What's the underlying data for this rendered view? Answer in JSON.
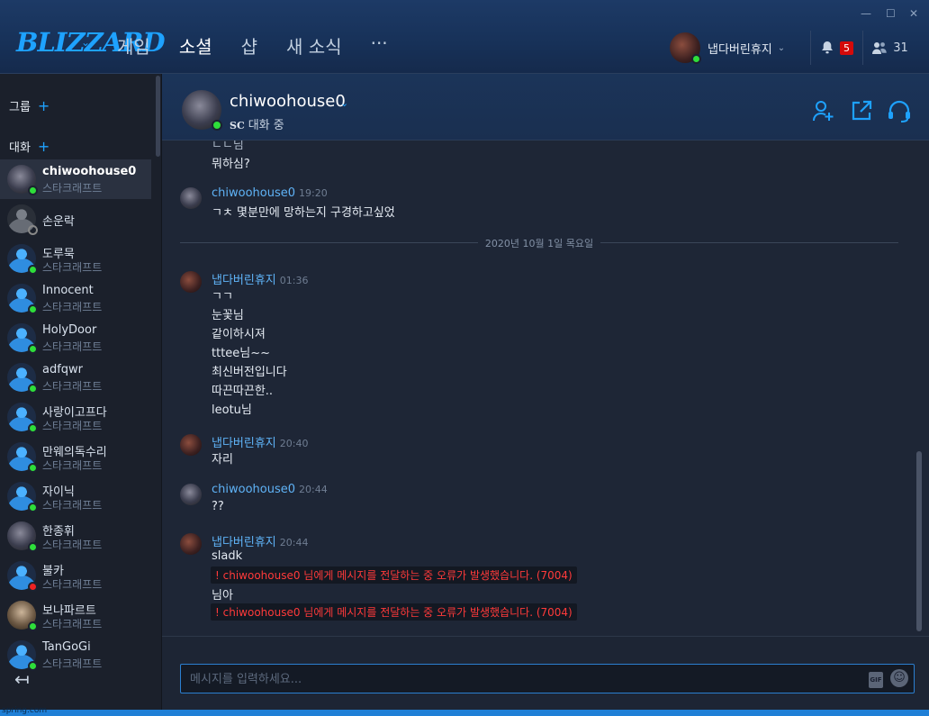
{
  "app": {
    "logo": "BLIZZARD",
    "nav": [
      "게임",
      "소셜",
      "샵",
      "새 소식",
      "···"
    ],
    "active_nav": 1,
    "window_controls": [
      "—",
      "☐",
      "✕"
    ]
  },
  "profile": {
    "name": "냅다버린휴지",
    "status": "online"
  },
  "notifications": {
    "count": "5"
  },
  "friends_online": {
    "count": "31"
  },
  "sidebar": {
    "groups_label": "그룹",
    "conversations_label": "대화",
    "friends": [
      {
        "name": "chiwoohouse0",
        "game": "스타크래프트",
        "status": "online",
        "avatar": "zerg",
        "selected": true
      },
      {
        "name": "손운락",
        "game": "",
        "status": "offline",
        "avatar": "grey"
      },
      {
        "name": "도루묵",
        "game": "스타크래프트",
        "status": "online",
        "avatar": "blue"
      },
      {
        "name": "Innocent",
        "game": "스타크래프트",
        "status": "online",
        "avatar": "blue"
      },
      {
        "name": "HolyDoor",
        "game": "스타크래프트",
        "status": "online",
        "avatar": "blue"
      },
      {
        "name": "adfqwr",
        "game": "스타크래프트",
        "status": "online",
        "avatar": "blue"
      },
      {
        "name": "사랑이고프다",
        "game": "스타크래프트",
        "status": "online",
        "avatar": "blue"
      },
      {
        "name": "만웨의독수리",
        "game": "스타크래프트",
        "status": "online",
        "avatar": "blue"
      },
      {
        "name": "자이닉",
        "game": "스타크래프트",
        "status": "online",
        "avatar": "blue"
      },
      {
        "name": "한종휘",
        "game": "스타크래프트",
        "status": "online",
        "avatar": "zerg"
      },
      {
        "name": "불카",
        "game": "스타크래프트",
        "status": "dnd",
        "avatar": "blue"
      },
      {
        "name": "보나파르트",
        "game": "스타크래프트",
        "status": "online",
        "avatar": "photo"
      },
      {
        "name": "TanGoGi",
        "game": "스타크래프트",
        "status": "online",
        "avatar": "blue"
      }
    ]
  },
  "chat": {
    "name": "chiwoohouse0",
    "status": "대화 중",
    "status_icon": "SC",
    "date_separator": "2020년 10월 1일 목요일",
    "top_partial_lines": [
      "ㄴㄴ님",
      "뭐하심?"
    ],
    "messages": [
      {
        "author": "chiwoohouse0",
        "time": "19:20",
        "avatar": "zerg",
        "lines": [
          "ㄱㅊ 몇분만에 망하는지 구경하고싶었"
        ]
      },
      {
        "author": "냅다버린휴지",
        "time": "01:36",
        "avatar": "me",
        "lines": [
          "ㄱㄱ",
          "눈꽃님",
          "같이하시져",
          "tttee님~~",
          "최신버전입니다",
          "따끈따끈한..",
          "leotu님"
        ]
      },
      {
        "author": "냅다버린휴지",
        "time": "20:40",
        "avatar": "me",
        "lines": [
          "자리"
        ]
      },
      {
        "author": "chiwoohouse0",
        "time": "20:44",
        "avatar": "zerg",
        "lines": [
          "??"
        ]
      },
      {
        "author": "냅다버린휴지",
        "time": "20:44",
        "avatar": "me",
        "lines": [
          "sladk"
        ]
      }
    ],
    "error_text": "! chiwoohouse0 님에게 메시지를 전달하는 중 오류가 발생했습니다. (7004)",
    "last_line": "님아"
  },
  "composer": {
    "placeholder": "메시지를 입력하세요...",
    "gif_label": "GIF",
    "emoji": "☺"
  },
  "footer": {
    "ghost_text": "spring.com"
  }
}
